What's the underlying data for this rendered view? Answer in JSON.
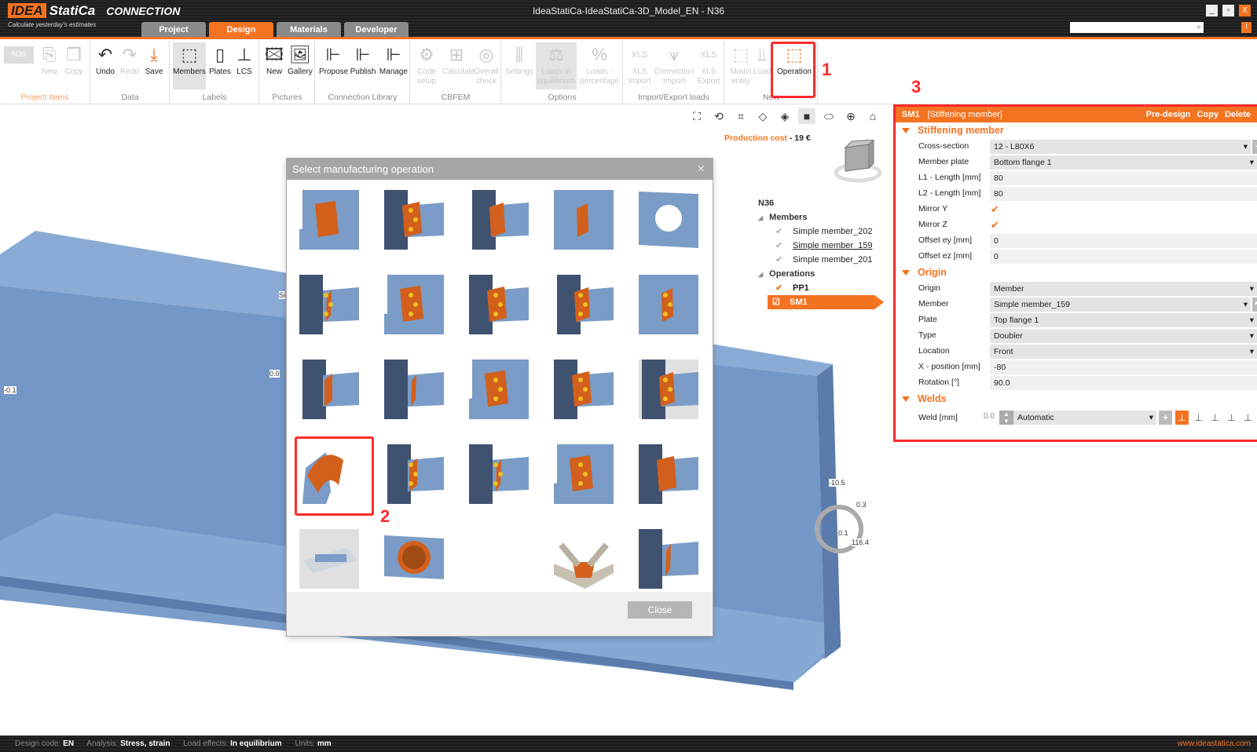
{
  "app": {
    "logo_brand": "IDEA",
    "logo_name": "StatiCa",
    "logo_product": "CONNECTION",
    "slogan": "Calculate yesterday's estimates",
    "window_title": "IdeaStatiCa-IdeaStatiCa-3D_Model_EN - N36",
    "window_buttons": {
      "minimize": "_",
      "maximize": "▫",
      "close": "X"
    },
    "info": "i",
    "search_icon": "⌕"
  },
  "tabs": [
    {
      "label": "Project"
    },
    {
      "label": "Design",
      "active": true
    },
    {
      "label": "Materials"
    },
    {
      "label": "Developer"
    }
  ],
  "ribbon": {
    "groups": [
      {
        "label": "Project items",
        "buttons": [
          {
            "label": "N36",
            "icon": "dropdown"
          },
          {
            "label": "New",
            "icon": "new-file-icon"
          },
          {
            "label": "Copy",
            "icon": "copy-icon"
          }
        ]
      },
      {
        "label": "Data",
        "buttons": [
          {
            "label": "Undo",
            "icon": "undo-icon"
          },
          {
            "label": "Redo",
            "icon": "redo-icon"
          },
          {
            "label": "Save",
            "icon": "save-icon"
          }
        ]
      },
      {
        "label": "Labels",
        "buttons": [
          {
            "label": "Members",
            "icon": "members-icon"
          },
          {
            "label": "Plates",
            "icon": "plates-icon"
          },
          {
            "label": "LCS",
            "icon": "lcs-icon"
          }
        ]
      },
      {
        "label": "Pictures",
        "buttons": [
          {
            "label": "New",
            "icon": "new-picture-icon"
          },
          {
            "label": "Gallery",
            "icon": "gallery-icon"
          }
        ]
      },
      {
        "label": "Connection Library",
        "buttons": [
          {
            "label": "Propose",
            "icon": "propose-icon"
          },
          {
            "label": "Publish",
            "icon": "publish-icon"
          },
          {
            "label": "Manage",
            "icon": "manage-icon"
          }
        ]
      },
      {
        "label": "CBFEM",
        "buttons": [
          {
            "label": "Code setup",
            "icon": "code-setup-icon"
          },
          {
            "label": "Calculate",
            "icon": "calculate-icon"
          },
          {
            "label": "Overall check",
            "icon": "overall-check-icon"
          }
        ]
      },
      {
        "label": "Options",
        "buttons": [
          {
            "label": "Settings",
            "icon": "settings-icon"
          },
          {
            "label": "Loads in equilibrium",
            "icon": "scales-icon"
          },
          {
            "label": "Loads - percentage",
            "icon": "loads-percentage-icon"
          }
        ]
      },
      {
        "label": "Import/Export loads",
        "buttons": [
          {
            "label": "XLS Import",
            "icon": "xls-import-icon"
          },
          {
            "label": "Connection Import",
            "icon": "connection-import-icon"
          },
          {
            "label": "XLS Export",
            "icon": "xls-export-icon"
          }
        ]
      },
      {
        "label": "New",
        "buttons": [
          {
            "label": "Model entity",
            "icon": "model-entity-icon"
          },
          {
            "label": "Load",
            "icon": "load-icon"
          },
          {
            "label": "Operation",
            "icon": "operation-icon"
          }
        ]
      }
    ]
  },
  "annotations": {
    "one": "1",
    "two": "2",
    "three": "3"
  },
  "viewport": {
    "production_cost_label": "Production cost",
    "production_cost_sep": "-",
    "production_cost_value": "19 €",
    "labels": {
      "a": "-0.1",
      "b": "0.0",
      "c": "-10.5",
      "d": "0.3",
      "e": "0.1",
      "f": "116.4",
      "g": "Si"
    },
    "tree": {
      "root": "N36",
      "members_label": "Members",
      "members": [
        "Simple member_202",
        "Simple member_159",
        "Simple member_201"
      ],
      "operations_label": "Operations",
      "operations": [
        "PP1",
        "SM1"
      ]
    }
  },
  "dialog": {
    "title": "Select manufacturing operation",
    "close_label": "Close",
    "close_icon": "×",
    "tiles": [
      [
        "stiffener-angle",
        "stiffening-plate",
        "haunch-stiffeners",
        "base-rib",
        "plate-opening"
      ],
      [
        "end-plate",
        "fin-plate-cut",
        "web-cleat",
        "splice-plate",
        "flange-cover-plate"
      ],
      [
        "gusset-bracing",
        "tube-gusset",
        "web-bolted-plate",
        "bolted-cleats",
        "base-plate-anchors"
      ],
      [
        "stiffening-member",
        "plate-doubler",
        "cleat-plate",
        "bolted-flange-plate",
        "flange-doubler"
      ],
      [
        "grout",
        "tube-opening",
        null,
        "chord-gusset",
        "beam-to-column-tube"
      ]
    ],
    "selected": [
      3,
      0
    ]
  },
  "panel": {
    "header_id": "SM1",
    "header_type": "[Stiffening member]",
    "actions": [
      "Pre-design",
      "Copy",
      "Delete"
    ],
    "stiffening": {
      "title": "Stiffening member",
      "rows": [
        {
          "label": "Cross-section",
          "value": "12 - L80X6",
          "kind": "dropdown-add"
        },
        {
          "label": "Member plate",
          "value": "Bottom flange 1",
          "kind": "dropdown"
        },
        {
          "label": "L1 - Length [mm]",
          "value": "80",
          "kind": "text"
        },
        {
          "label": "L2 - Length [mm]",
          "value": "80",
          "kind": "text"
        },
        {
          "label": "Mirror Y",
          "value": "✔",
          "kind": "check"
        },
        {
          "label": "Mirror Z",
          "value": "✔",
          "kind": "check"
        },
        {
          "label": "Offset ey [mm]",
          "value": "0",
          "kind": "text"
        },
        {
          "label": "Offset ez [mm]",
          "value": "0",
          "kind": "text"
        }
      ]
    },
    "origin": {
      "title": "Origin",
      "rows": [
        {
          "label": "Origin",
          "value": "Member",
          "kind": "dropdown"
        },
        {
          "label": "Member",
          "value": "Simple member_159",
          "kind": "dropdown-pick"
        },
        {
          "label": "Plate",
          "value": "Top flange 1",
          "kind": "dropdown"
        },
        {
          "label": "Type",
          "value": "Doubler",
          "kind": "dropdown"
        },
        {
          "label": "Location",
          "value": "Front",
          "kind": "dropdown"
        },
        {
          "label": "X - position [mm]",
          "value": "-80",
          "kind": "text"
        },
        {
          "label": "Rotation [°]",
          "value": "90.0",
          "kind": "text"
        }
      ]
    },
    "welds": {
      "title": "Welds",
      "label": "Weld [mm]",
      "size": "0.0",
      "type": "Automatic"
    }
  },
  "status": {
    "design_code_label": "Design code:",
    "design_code": "EN",
    "analysis_label": "Analysis:",
    "analysis": "Stress, strain",
    "load_effects_label": "Load effects:",
    "load_effects": "In equilibrium",
    "units_label": "Units:",
    "units": "mm",
    "url": "www.ideastatica.com"
  },
  "colors": {
    "accent": "#f47321",
    "steel": "#7a9cc6",
    "highlight": "#ff2a2a"
  }
}
